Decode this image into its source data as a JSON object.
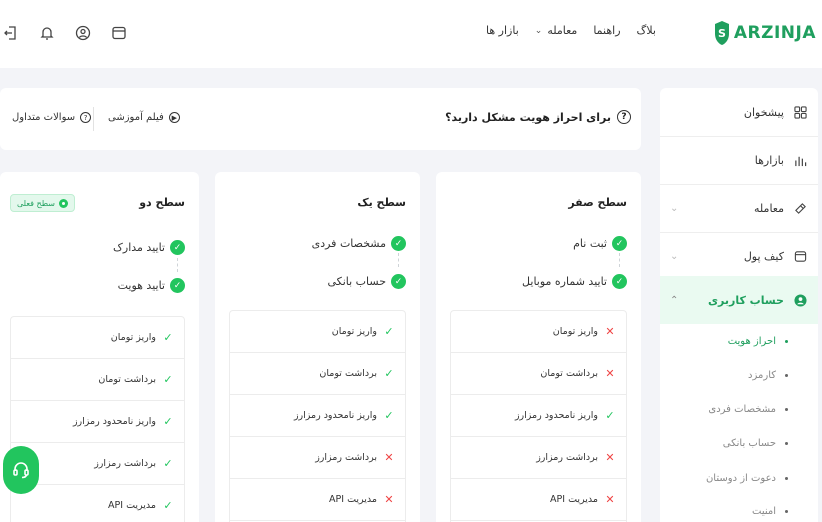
{
  "header": {
    "logo_text": "ARZINJA",
    "nav": [
      {
        "label": "بازار ها",
        "has_dropdown": false
      },
      {
        "label": "معامله",
        "has_dropdown": true
      },
      {
        "label": "راهنما",
        "has_dropdown": false
      },
      {
        "label": "بلاگ",
        "has_dropdown": false
      }
    ],
    "icons": [
      "wallet-icon",
      "user-circle-icon",
      "bell-icon",
      "logout-icon"
    ]
  },
  "sidebar": {
    "items": [
      {
        "label": "پیشخوان",
        "icon": "dashboard-icon",
        "has_chevron": false
      },
      {
        "label": "بازارها",
        "icon": "bar-chart-icon",
        "has_chevron": false
      },
      {
        "label": "معامله",
        "icon": "exchange-icon",
        "has_chevron": true
      },
      {
        "label": "کیف پول",
        "icon": "wallet-icon",
        "has_chevron": true
      },
      {
        "label": "حساب کاربری",
        "icon": "user-icon",
        "has_chevron": true,
        "active": true
      }
    ],
    "sub_items": [
      {
        "label": "احراز هویت",
        "active": true
      },
      {
        "label": "کارمزد",
        "active": false
      },
      {
        "label": "مشخصات فردی",
        "active": false
      },
      {
        "label": "حساب بانکی",
        "active": false
      },
      {
        "label": "دعوت از دوستان",
        "active": false
      },
      {
        "label": "امنیت",
        "active": false
      }
    ]
  },
  "help": {
    "question": "برای احراز هویت مشکل دارید؟",
    "video_link": "فیلم آموزشی",
    "faq_link": "سوالات متداول"
  },
  "levels": [
    {
      "title": "سطح صفر",
      "requirements": [
        "ثبت نام",
        "تایید شماره موبایل"
      ],
      "permissions": [
        {
          "label": "واریز تومان",
          "allowed": false
        },
        {
          "label": "برداشت تومان",
          "allowed": false
        },
        {
          "label": "واریز نامحدود رمزارز",
          "allowed": true
        },
        {
          "label": "برداشت رمزارز",
          "allowed": false
        },
        {
          "label": "مدیریت API",
          "allowed": false
        }
      ]
    },
    {
      "title": "سطح یک",
      "requirements": [
        "مشخصات فردی",
        "حساب بانکی"
      ],
      "permissions": [
        {
          "label": "واریز تومان",
          "allowed": true
        },
        {
          "label": "برداشت تومان",
          "allowed": true
        },
        {
          "label": "واریز نامحدود رمزارز",
          "allowed": true
        },
        {
          "label": "برداشت رمزارز",
          "allowed": false
        },
        {
          "label": "مدیریت API",
          "allowed": false
        }
      ]
    },
    {
      "title": "سطح دو",
      "badge": "سطح فعلی",
      "requirements": [
        "تایید مدارک",
        "تایید هویت"
      ],
      "permissions": [
        {
          "label": "واریز تومان",
          "allowed": true
        },
        {
          "label": "برداشت تومان",
          "allowed": true
        },
        {
          "label": "واریز نامحدود رمزارز",
          "allowed": true
        },
        {
          "label": "برداشت رمزارز",
          "allowed": true
        },
        {
          "label": "مدیریت API",
          "allowed": true
        }
      ]
    }
  ],
  "colors": {
    "accent": "#22c55e",
    "brand": "#1f9f5e",
    "error": "#ef4444"
  }
}
